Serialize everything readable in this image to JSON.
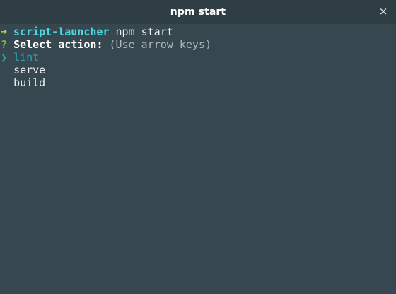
{
  "window": {
    "title": "npm start",
    "close_symbol": "×"
  },
  "terminal": {
    "prompt_symbol": "➜",
    "cwd": "script-launcher",
    "command": "npm start",
    "question_mark": "?",
    "question": "Select action:",
    "hint": "(Use arrow keys)",
    "pointer_symbol": "❯",
    "options": [
      {
        "label": "lint",
        "selected": true
      },
      {
        "label": "serve",
        "selected": false
      },
      {
        "label": "build",
        "selected": false
      }
    ]
  },
  "colors": {
    "background": "#37474f",
    "titlebar": "#2f3e45",
    "accent_cyan": "#26a6b0",
    "prompt_green": "#b5e61d"
  }
}
